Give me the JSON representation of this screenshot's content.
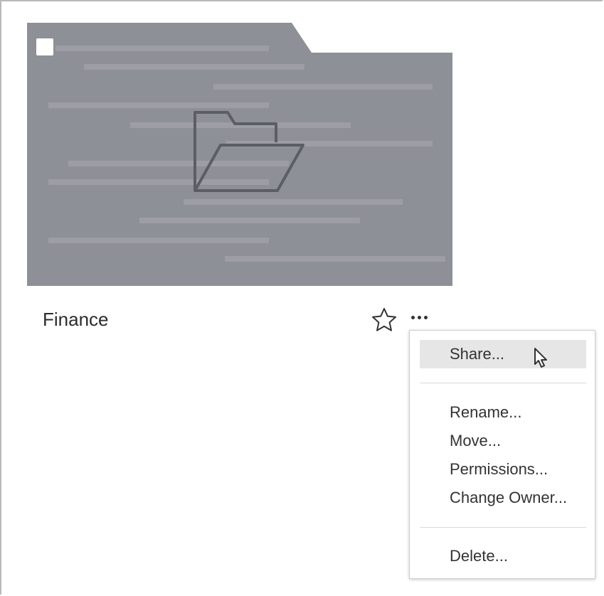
{
  "card": {
    "title": "Finance",
    "thumbnail_icon": "folder-icon",
    "favorite_icon": "star-outline-icon",
    "more_icon": "ellipsis-icon",
    "thumbnail_color": "#8e9097",
    "thumbnail_line_color": "#9d9ea5",
    "folder_stroke_color": "#5c5e66"
  },
  "context_menu": {
    "items": [
      {
        "label": "Share...",
        "highlighted": true
      },
      {
        "label": "Rename...",
        "highlighted": false
      },
      {
        "label": "Move...",
        "highlighted": false
      },
      {
        "label": "Permissions...",
        "highlighted": false
      },
      {
        "label": "Change Owner...",
        "highlighted": false
      },
      {
        "label": "Delete...",
        "highlighted": false
      }
    ],
    "highlight_color": "#e6e6e6"
  },
  "cursor_icon": "mouse-pointer-icon"
}
